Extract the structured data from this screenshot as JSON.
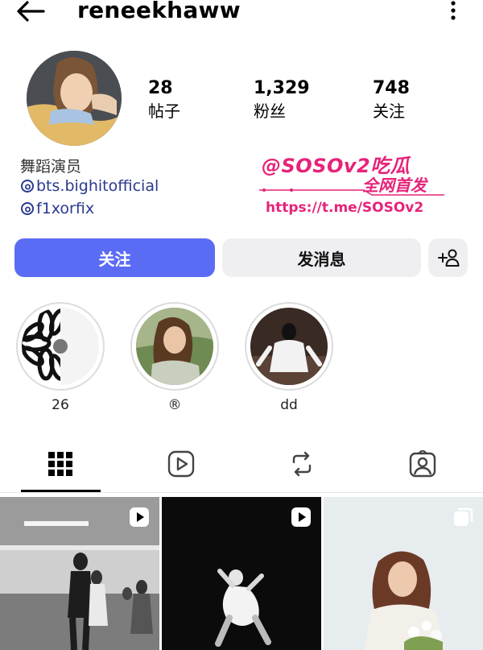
{
  "header": {
    "username": "reneekhaww",
    "back_icon": "arrow-left-icon",
    "more_icon": "more-vertical-icon"
  },
  "stats": [
    {
      "value": "28",
      "label": "帖子"
    },
    {
      "value": "1,329",
      "label": "粉丝"
    },
    {
      "value": "748",
      "label": "关注"
    }
  ],
  "bio": {
    "title": "舞蹈演员",
    "links": [
      "bts.bighitofficial",
      "f1xorfix"
    ]
  },
  "watermark": {
    "line1": "@SOSOv2吃瓜",
    "line2": "全网首发",
    "line3": "https://t.me/SOSOv2"
  },
  "actions": {
    "follow_label": "关注",
    "message_label": "发消息",
    "add_user_icon": "person-add-icon"
  },
  "highlights": [
    {
      "label": "26"
    },
    {
      "label": "®"
    },
    {
      "label": "dd"
    }
  ],
  "tabs": [
    {
      "name": "grid",
      "icon": "grid-icon",
      "active": true
    },
    {
      "name": "reels",
      "icon": "reels-icon",
      "active": false
    },
    {
      "name": "reposts",
      "icon": "repost-icon",
      "active": false
    },
    {
      "name": "tagged",
      "icon": "tagged-person-icon",
      "active": false
    }
  ],
  "colors": {
    "accent": "#5b6cf4",
    "watermark": "#e6237a",
    "link": "#2a3a8f"
  }
}
